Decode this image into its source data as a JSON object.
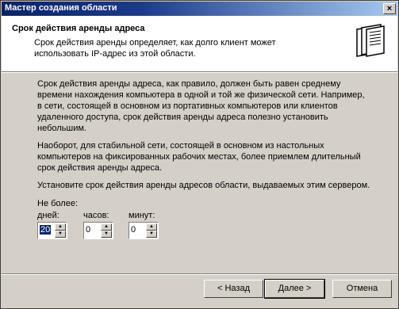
{
  "window": {
    "title": "Мастер создания области",
    "close_glyph": "×"
  },
  "header": {
    "title": "Срок действия аренды адреса",
    "subtitle": "Срок действия аренды определяет, как долго клиент может использовать IP-адрес из этой области.",
    "icon": "folder-stack-icon"
  },
  "body": {
    "p1": "Срок действия аренды адреса, как правило, должен быть равен  среднему времени нахождения компьютера в одной и той же физической сети. Например, в сети, состоящей в основном из портативных компьютеров или клиентов удаленного доступа, срок действия аренды адреса полезно установить небольшим.",
    "p2": "Наоборот, для стабильной сети, состоящей в основном из настольных компьютеров на фиксированных рабочих местах, более приемлем длительный срок действия аренды адреса.",
    "p3": "Установите срок действия аренды адресов области, выдаваемых этим сервером."
  },
  "lease": {
    "no_more_label": "Не более:",
    "days_label": "дней:",
    "days_value": "20",
    "hours_label": "часов:",
    "hours_value": "0",
    "minutes_label": "минут:",
    "minutes_value": "0"
  },
  "buttons": {
    "back": "< Назад",
    "next": "Далее >",
    "cancel": "Отмена"
  }
}
